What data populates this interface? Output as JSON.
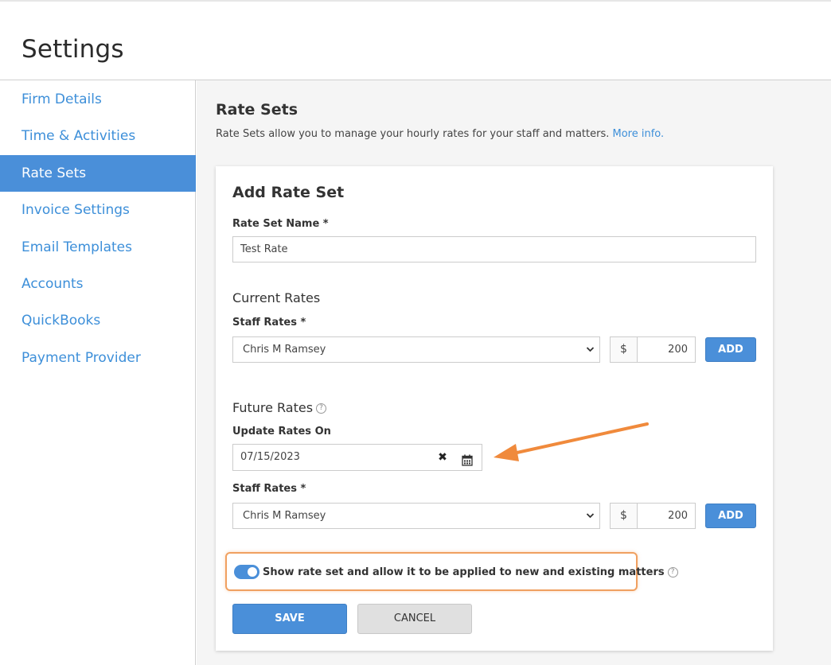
{
  "page_title": "Settings",
  "sidebar": {
    "items": [
      {
        "label": "Firm Details",
        "active": false
      },
      {
        "label": "Time & Activities",
        "active": false
      },
      {
        "label": "Rate Sets",
        "active": true
      },
      {
        "label": "Invoice Settings",
        "active": false
      },
      {
        "label": "Email Templates",
        "active": false
      },
      {
        "label": "Accounts",
        "active": false
      },
      {
        "label": "QuickBooks",
        "active": false
      },
      {
        "label": "Payment Provider",
        "active": false
      }
    ]
  },
  "main": {
    "title": "Rate Sets",
    "description": "Rate Sets allow you to manage your hourly rates for your staff and matters.",
    "more_info_link": "More info."
  },
  "form": {
    "title": "Add Rate Set",
    "name_label": "Rate Set Name *",
    "name_value": "Test Rate",
    "current_rates": {
      "title": "Current Rates",
      "staff_label": "Staff Rates *",
      "staff_selected": "Chris M Ramsey",
      "currency": "$",
      "rate_value": "200",
      "add_label": "ADD"
    },
    "future_rates": {
      "title": "Future Rates",
      "help": "?",
      "update_label": "Update Rates On",
      "date_value": "07/15/2023",
      "clear_icon": "✖",
      "staff_label": "Staff Rates *",
      "staff_selected": "Chris M Ramsey",
      "currency": "$",
      "rate_value": "200",
      "add_label": "ADD"
    },
    "toggle": {
      "label": "Show rate set and allow it to be applied to new and existing matters",
      "help": "?",
      "checked": true
    },
    "save_label": "SAVE",
    "cancel_label": "CANCEL"
  },
  "colors": {
    "accent": "#4a8fd9",
    "link": "#3d8fd9",
    "highlight_border": "#f0a060",
    "annotation_arrow": "#f08a3c"
  },
  "icons": {
    "chevron": "chevron-down-icon",
    "calendar": "calendar-icon",
    "clear": "clear-icon",
    "help": "help-circle-icon",
    "arrow": "annotation-arrow-icon"
  }
}
